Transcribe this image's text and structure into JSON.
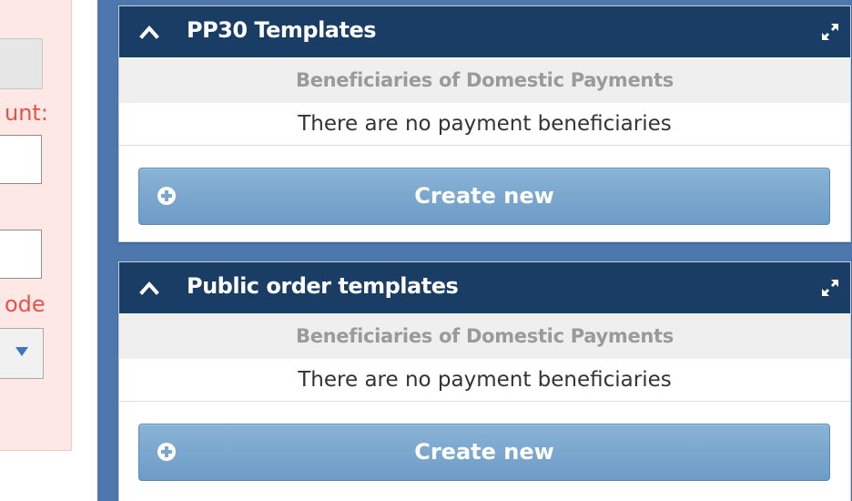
{
  "left_form": {
    "label_1": "unt:",
    "label_2": "ode"
  },
  "widgets": [
    {
      "title": "PP30 Templates",
      "subheader": "Beneficiaries of Domestic Payments",
      "empty_text": "There are no payment beneficiaries",
      "button_label": "Create new"
    },
    {
      "title": "Public order templates",
      "subheader": "Beneficiaries of Domestic Payments",
      "empty_text": "There are no payment beneficiaries",
      "button_label": "Create new"
    }
  ],
  "colors": {
    "header_bg": "#1a3d66",
    "frame_bg": "#4e78ad",
    "button_bg": "#7aa7cf",
    "left_panel_bg": "#fde8e6",
    "label_red": "#e8524a"
  },
  "icons": {
    "collapse": "chevron-up-icon",
    "expand": "expand-arrows-icon",
    "add": "plus-circle-icon",
    "dropdown": "caret-down-icon"
  }
}
